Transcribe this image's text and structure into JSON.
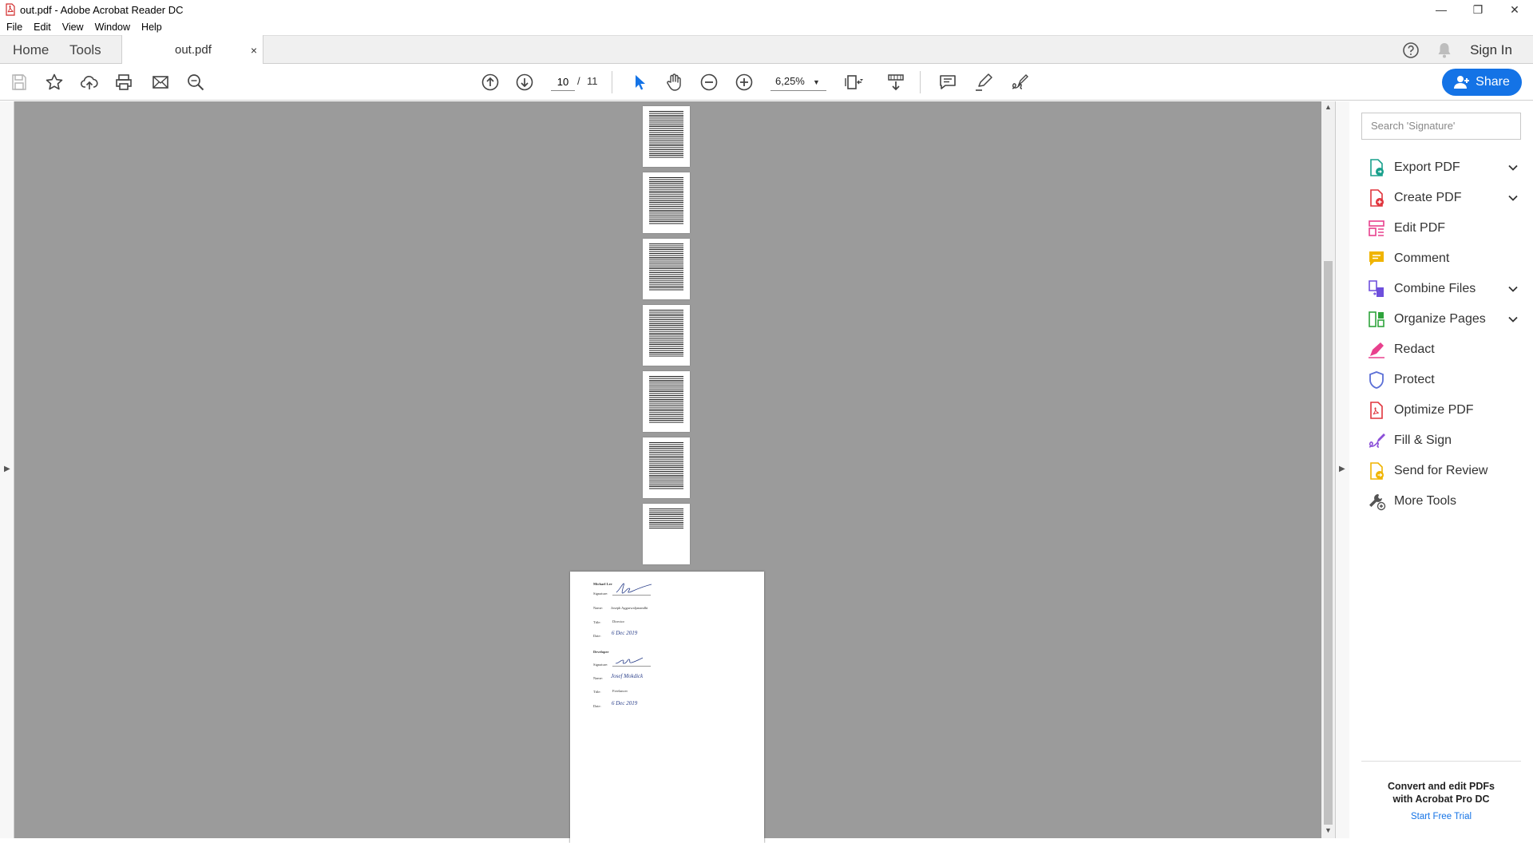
{
  "window": {
    "title": "out.pdf - Adobe Acrobat Reader DC",
    "controls": [
      "minimize-icon",
      "restore-icon",
      "close-icon"
    ]
  },
  "menu": [
    "File",
    "Edit",
    "View",
    "Window",
    "Help"
  ],
  "tabs": {
    "home": "Home",
    "tools": "Tools",
    "document": "out.pdf",
    "close": "×",
    "sign_in": "Sign In"
  },
  "toolbar": {
    "current_page": "10",
    "page_sep": "/",
    "total_pages": "11",
    "zoom": "6,25%",
    "zoom_arrow": "▼",
    "share": "Share"
  },
  "document": {
    "thumbnail_pages": 7,
    "signature_page": {
      "section1": "Michael Lee",
      "signature_label": "Signature:",
      "name_label": "Name:",
      "name1": "Joseph Aggarwaljanandhi",
      "title_label": "Title:",
      "title1": "Director",
      "date_label": "Date:",
      "date1": "6 Dec 2019",
      "section2": "Developer",
      "name2": "Josef Mokdick",
      "title2": "Freelancer",
      "date2": "6 Dec 2019"
    }
  },
  "panel": {
    "search_placeholder": "Search 'Signature'",
    "tools": [
      {
        "label": "Export PDF",
        "icon": "export-pdf-icon",
        "color": "#19a08c",
        "expand": true
      },
      {
        "label": "Create PDF",
        "icon": "create-pdf-icon",
        "color": "#e0353d",
        "expand": true
      },
      {
        "label": "Edit PDF",
        "icon": "edit-pdf-icon",
        "color": "#e8408d",
        "expand": false
      },
      {
        "label": "Comment",
        "icon": "comment-icon",
        "color": "#f0b400",
        "expand": false
      },
      {
        "label": "Combine Files",
        "icon": "combine-files-icon",
        "color": "#6e4fdc",
        "expand": true
      },
      {
        "label": "Organize Pages",
        "icon": "organize-pages-icon",
        "color": "#2fa43c",
        "expand": true
      },
      {
        "label": "Redact",
        "icon": "redact-icon",
        "color": "#e8408d",
        "expand": false
      },
      {
        "label": "Protect",
        "icon": "protect-icon",
        "color": "#5b6fd6",
        "expand": false
      },
      {
        "label": "Optimize PDF",
        "icon": "optimize-pdf-icon",
        "color": "#e0353d",
        "expand": false
      },
      {
        "label": "Fill & Sign",
        "icon": "fill-sign-icon",
        "color": "#8b4fd8",
        "expand": false
      },
      {
        "label": "Send for Review",
        "icon": "send-review-icon",
        "color": "#f0b400",
        "expand": false
      },
      {
        "label": "More Tools",
        "icon": "more-tools-icon",
        "color": "#555555",
        "expand": false
      }
    ],
    "promo_line1": "Convert and edit PDFs",
    "promo_line2": "with Acrobat Pro DC",
    "promo_link": "Start Free Trial"
  },
  "colors": {
    "accent": "#1473e6",
    "viewer_bg": "#9b9b9b"
  }
}
